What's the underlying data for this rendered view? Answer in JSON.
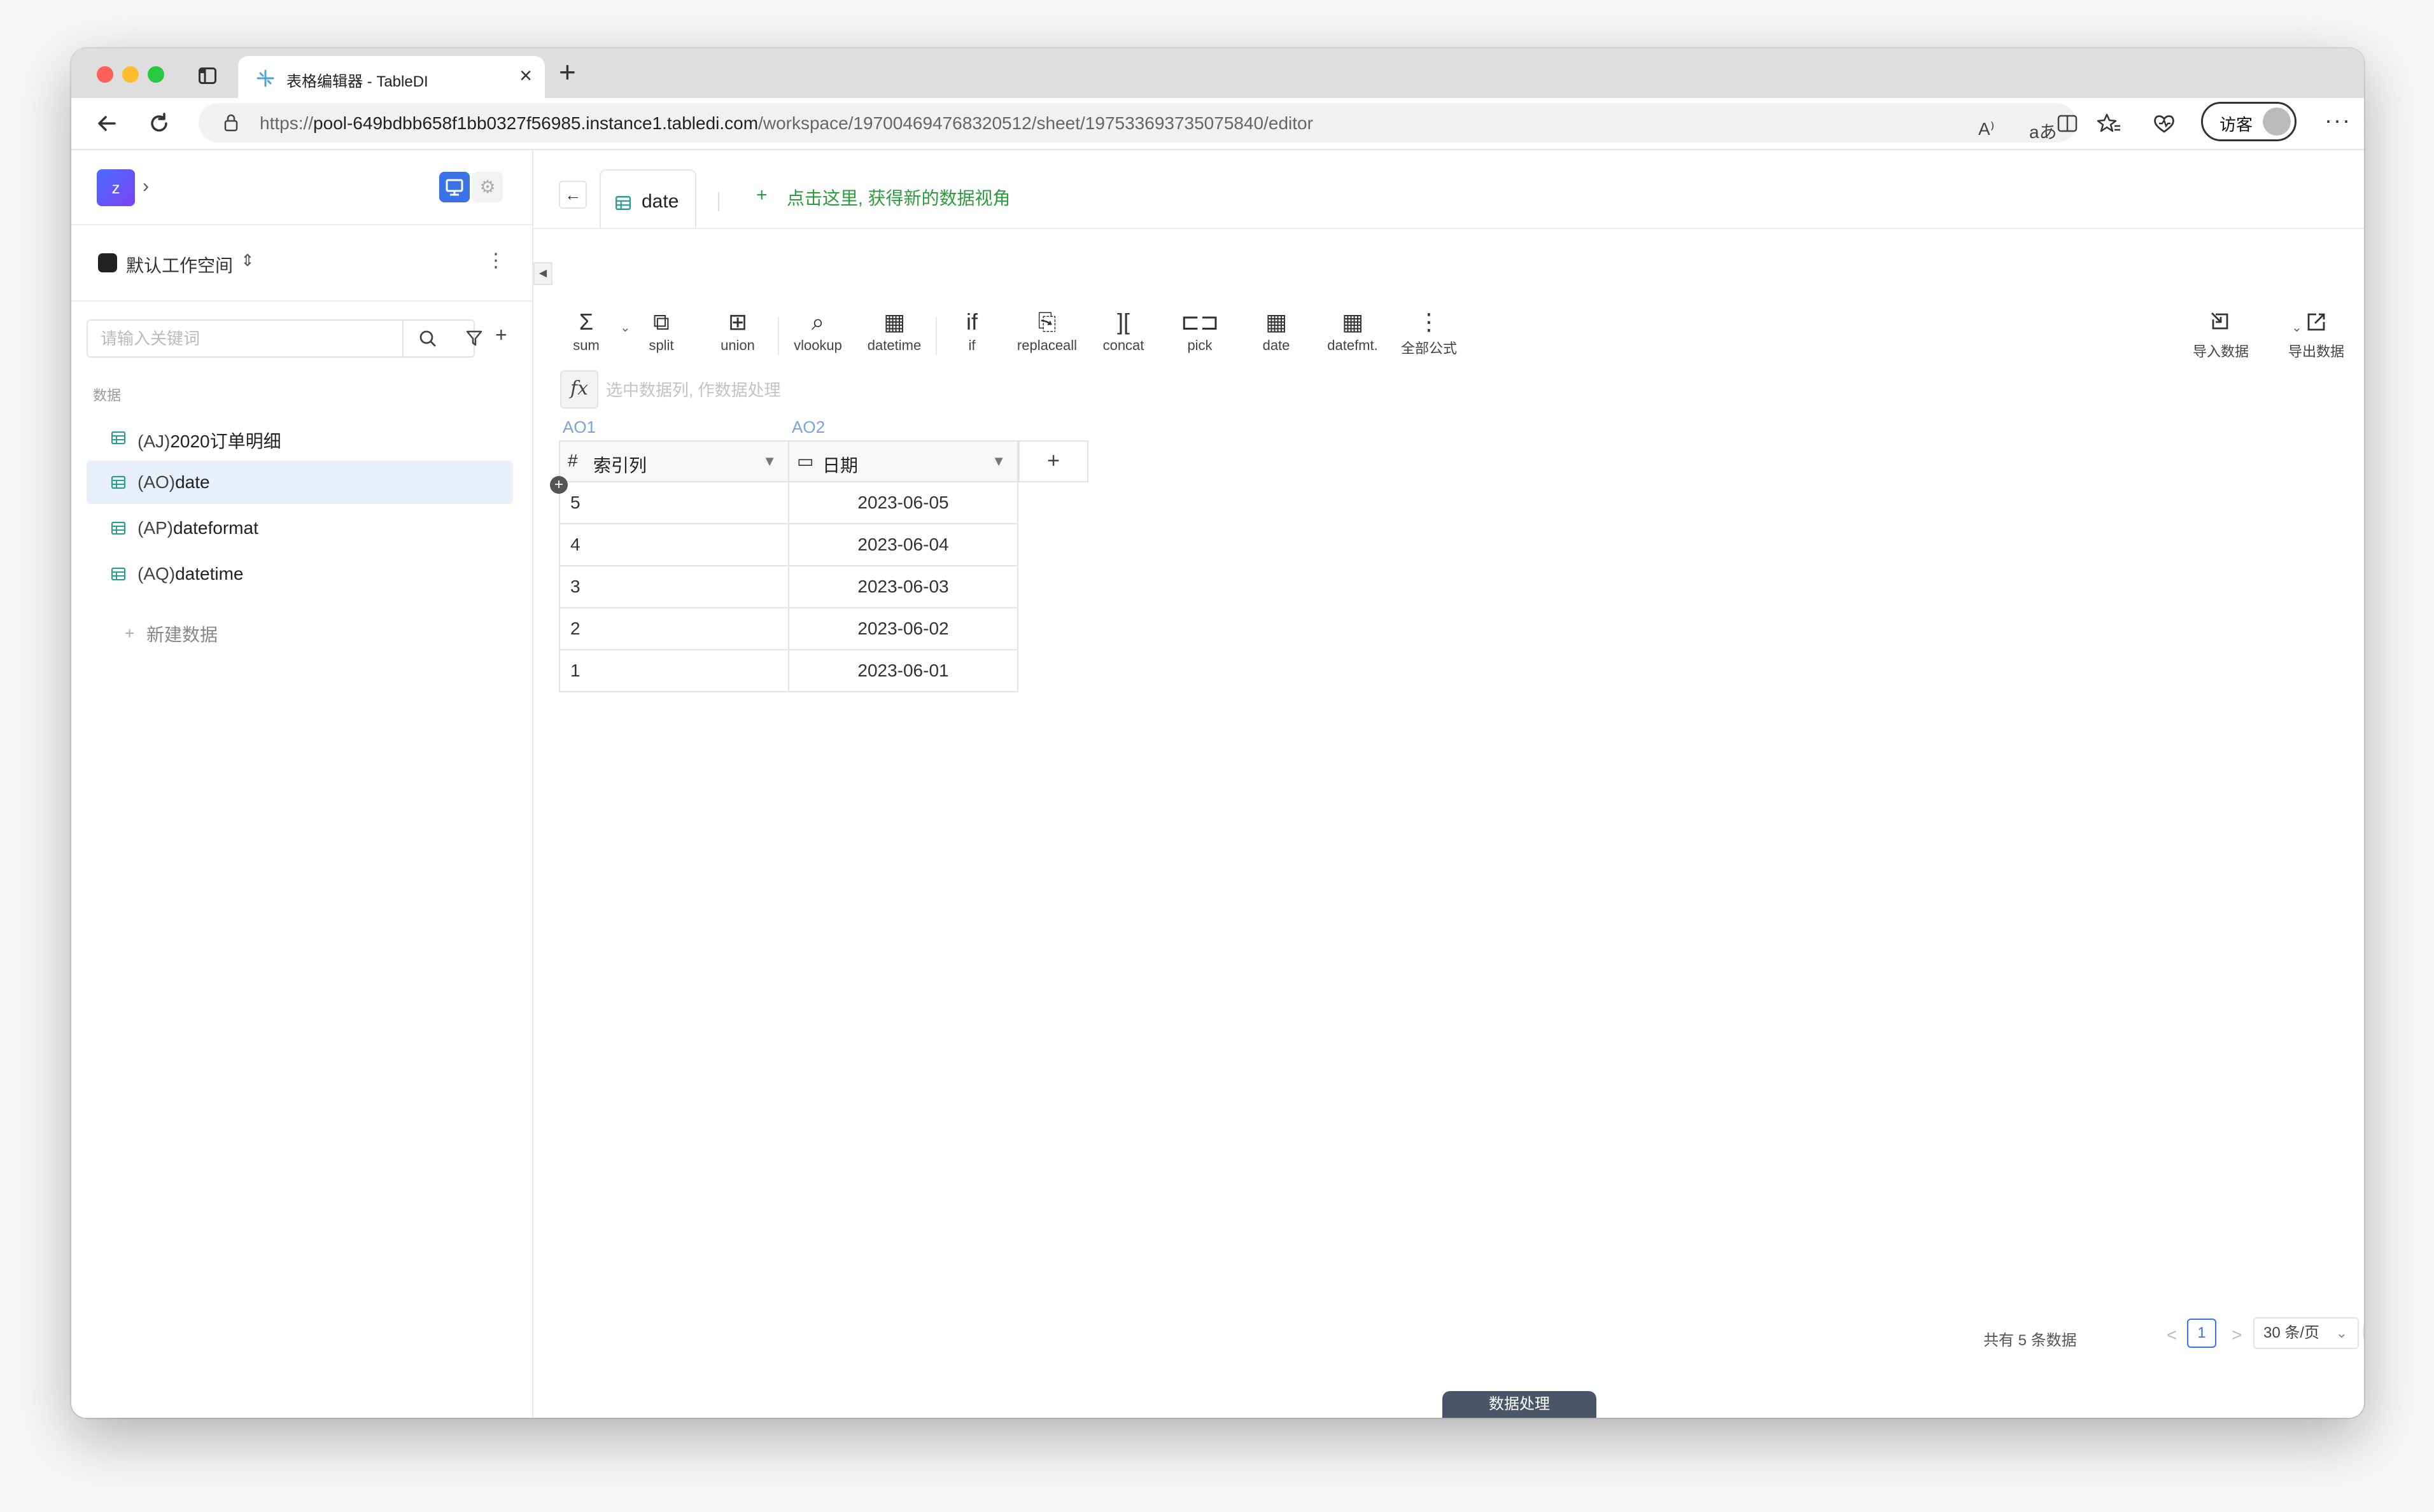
{
  "browser": {
    "tab_title": "表格编辑器 - TableDI",
    "tab_close": "×",
    "new_tab": "+",
    "url_scheme": "https://",
    "url_host": "pool-649bdbb658f1bb0327f56985.instance1.tabledi.com",
    "url_path": "/workspace/197004694768320512/sheet/197533693735075840/editor",
    "read_aloud": "A⁾",
    "translate": "aあ",
    "guest_label": "访客",
    "more": "···"
  },
  "sidebar": {
    "logo_letter": "z",
    "workspace_name": "默认工作空间",
    "workspace_caret": "⌃⌄",
    "search_placeholder": "请输入关键词",
    "section_label": "数据",
    "items": [
      {
        "code": "(AJ)",
        "name": "2020订单明细"
      },
      {
        "code": "(AO)",
        "name": "date"
      },
      {
        "code": "(AP)",
        "name": "dateformat"
      },
      {
        "code": "(AQ)",
        "name": "datetime"
      }
    ],
    "new_data_label": "新建数据"
  },
  "sheet": {
    "tab_label": "date",
    "hint": "点击这里, 获得新的数据视角"
  },
  "toolbar": {
    "tools": [
      {
        "glyph": "Σ",
        "label": "sum"
      },
      {
        "glyph": "⧉",
        "label": "split"
      },
      {
        "glyph": "⊞",
        "label": "union"
      },
      {
        "glyph": "⌕",
        "label": "vlookup"
      },
      {
        "glyph": "▦",
        "label": "datetime"
      },
      {
        "glyph": "if",
        "label": "if"
      },
      {
        "glyph": "⎘",
        "label": "replaceall"
      },
      {
        "glyph": "][",
        "label": "concat"
      },
      {
        "glyph": "⊏⊐",
        "label": "pick"
      },
      {
        "glyph": "▦",
        "label": "date"
      },
      {
        "glyph": "▦",
        "label": "datefmt."
      },
      {
        "glyph": "⋮",
        "label": "全部公式"
      }
    ],
    "import_label": "导入数据",
    "export_label": "导出数据",
    "formula_placeholder": "选中数据列, 作数据处理"
  },
  "table": {
    "columns": [
      {
        "code": "AO1",
        "icon": "#",
        "name": "索引列"
      },
      {
        "code": "AO2",
        "icon": "▭",
        "name": "日期"
      }
    ],
    "rows": [
      {
        "idx": "5",
        "date": "2023-06-05"
      },
      {
        "idx": "4",
        "date": "2023-06-04"
      },
      {
        "idx": "3",
        "date": "2023-06-03"
      },
      {
        "idx": "2",
        "date": "2023-06-02"
      },
      {
        "idx": "1",
        "date": "2023-06-01"
      }
    ]
  },
  "pagination": {
    "total_label": "共有 5 条数据",
    "prev": "<",
    "current_page": "1",
    "next": ">",
    "page_size": "30 条/页"
  },
  "bottom_tab_label": "数据处理",
  "colors": {
    "accent": "#3a72e8",
    "hint_green": "#2e9b3f",
    "column_code": "#7ba3d6",
    "active_row": "#e9f0fb"
  }
}
